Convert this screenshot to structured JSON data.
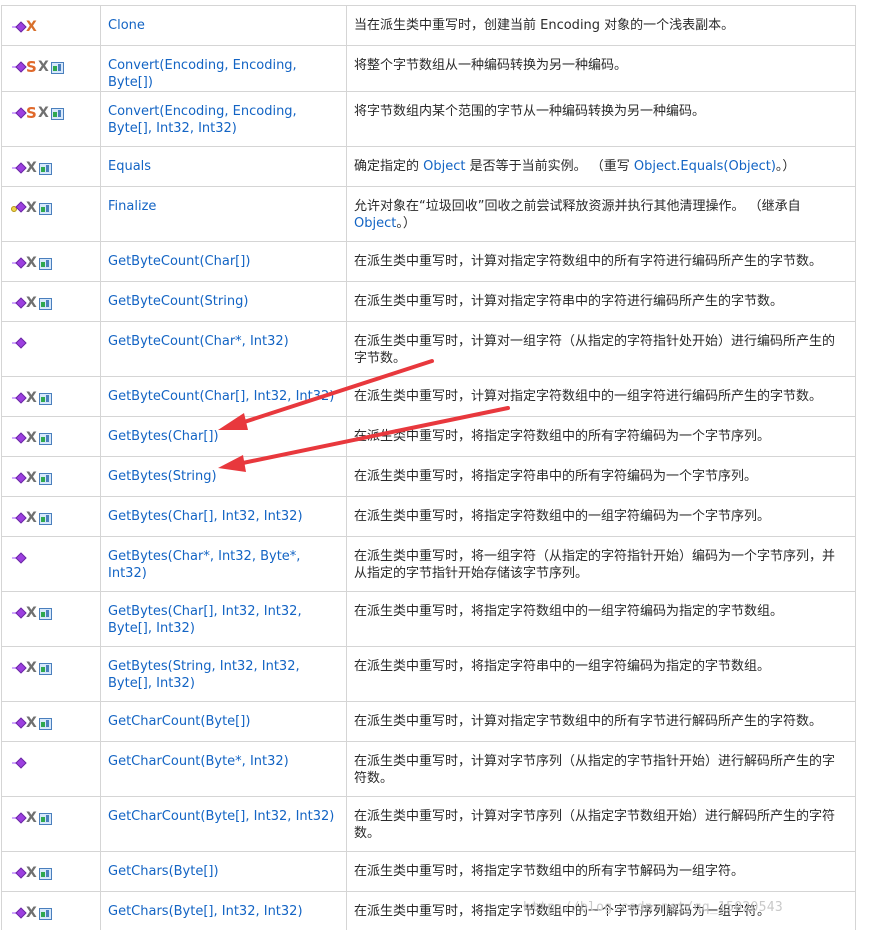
{
  "rows": [
    {
      "icons": [
        "method",
        "x-orange"
      ],
      "name": "Clone",
      "desc": "当在派生类中重写时，创建当前 Encoding 对象的一个浅表副本。",
      "h": 40
    },
    {
      "icons": [
        "method",
        "static",
        "x",
        "xna"
      ],
      "name": "Convert(Encoding, Encoding, Byte[])",
      "desc": "将整个字节数组从一种编码转换为另一种编码。",
      "h": 40
    },
    {
      "icons": [
        "method",
        "static",
        "x",
        "xna"
      ],
      "name": "Convert(Encoding, Encoding, Byte[], Int32, Int32)",
      "desc": "将字节数组内某个范围的字节从一种编码转换为另一种编码。",
      "h": 55
    },
    {
      "icons": [
        "method",
        "x",
        "xna"
      ],
      "name": "Equals",
      "desc_parts": [
        "确定指定的 ",
        "Object",
        " 是否等于当前实例。 （重写 ",
        "Object.Equals(Object)",
        "。）"
      ],
      "h": 40
    },
    {
      "icons": [
        "protected",
        "x",
        "xna"
      ],
      "name": "Finalize",
      "desc_parts": [
        "允许对象在“垃圾回收”回收之前尝试释放资源并执行其他清理操作。 （继承自 ",
        "Object",
        "。）"
      ],
      "h": 55
    },
    {
      "icons": [
        "method",
        "x",
        "xna"
      ],
      "name": "GetByteCount(Char[])",
      "desc": "在派生类中重写时，计算对指定字符数组中的所有字符进行编码所产生的字节数。",
      "h": 40
    },
    {
      "icons": [
        "method",
        "x",
        "xna"
      ],
      "name": "GetByteCount(String)",
      "desc": "在派生类中重写时，计算对指定字符串中的字符进行编码所产生的字节数。",
      "h": 40
    },
    {
      "icons": [
        "method"
      ],
      "name": "GetByteCount(Char*, Int32)",
      "desc": "在派生类中重写时，计算对一组字符（从指定的字符指针处开始）进行编码所产生的字节数。",
      "h": 55
    },
    {
      "icons": [
        "method",
        "x",
        "xna"
      ],
      "name": "GetByteCount(Char[], Int32, Int32)",
      "desc": "在派生类中重写时，计算对指定字符数组中的一组字符进行编码所产生的字节数。",
      "h": 40
    },
    {
      "icons": [
        "method",
        "x",
        "xna"
      ],
      "name": "GetBytes(Char[])",
      "desc": "在派生类中重写时，将指定字符数组中的所有字符编码为一个字节序列。",
      "h": 40
    },
    {
      "icons": [
        "method",
        "x",
        "xna"
      ],
      "name": "GetBytes(String)",
      "desc": "在派生类中重写时，将指定字符串中的所有字符编码为一个字节序列。",
      "h": 40
    },
    {
      "icons": [
        "method",
        "x",
        "xna"
      ],
      "name": "GetBytes(Char[], Int32, Int32)",
      "desc": "在派生类中重写时，将指定字符数组中的一组字符编码为一个字节序列。",
      "h": 40
    },
    {
      "icons": [
        "method"
      ],
      "name": "GetBytes(Char*, Int32, Byte*, Int32)",
      "desc": "在派生类中重写时，将一组字符（从指定的字符指针开始）编码为一个字节序列，并从指定的字节指针开始存储该字节序列。",
      "h": 55
    },
    {
      "icons": [
        "method",
        "x",
        "xna"
      ],
      "name": "GetBytes(Char[], Int32, Int32, Byte[], Int32)",
      "desc": "在派生类中重写时，将指定字符数组中的一组字符编码为指定的字节数组。",
      "h": 55
    },
    {
      "icons": [
        "method",
        "x",
        "xna"
      ],
      "name": "GetBytes(String, Int32, Int32, Byte[], Int32)",
      "desc": "在派生类中重写时，将指定字符串中的一组字符编码为指定的字节数组。",
      "h": 55
    },
    {
      "icons": [
        "method",
        "x",
        "xna"
      ],
      "name": "GetCharCount(Byte[])",
      "desc": "在派生类中重写时，计算对指定字节数组中的所有字节进行解码所产生的字符数。",
      "h": 40
    },
    {
      "icons": [
        "method"
      ],
      "name": "GetCharCount(Byte*, Int32)",
      "desc": "在派生类中重写时，计算对字节序列（从指定的字节指针开始）进行解码所产生的字符数。",
      "h": 55
    },
    {
      "icons": [
        "method",
        "x",
        "xna"
      ],
      "name": "GetCharCount(Byte[], Int32, Int32)",
      "desc": "在派生类中重写时，计算对字节序列（从指定字节数组开始）进行解码所产生的字符数。",
      "h": 55
    },
    {
      "icons": [
        "method",
        "x",
        "xna"
      ],
      "name": "GetChars(Byte[])",
      "desc": "在派生类中重写时，将指定字节数组中的所有字节解码为一组字符。",
      "h": 40
    },
    {
      "icons": [
        "method",
        "x",
        "xna"
      ],
      "name": "GetChars(Byte[], Int32, Int32)",
      "desc": "在派生类中重写时，将指定字节数组中的一个字节序列解码为一组字符。",
      "h": 40
    }
  ],
  "watermark": "http://blog.csdn.net/qq_15020543",
  "annotation_color": "#e8383d"
}
